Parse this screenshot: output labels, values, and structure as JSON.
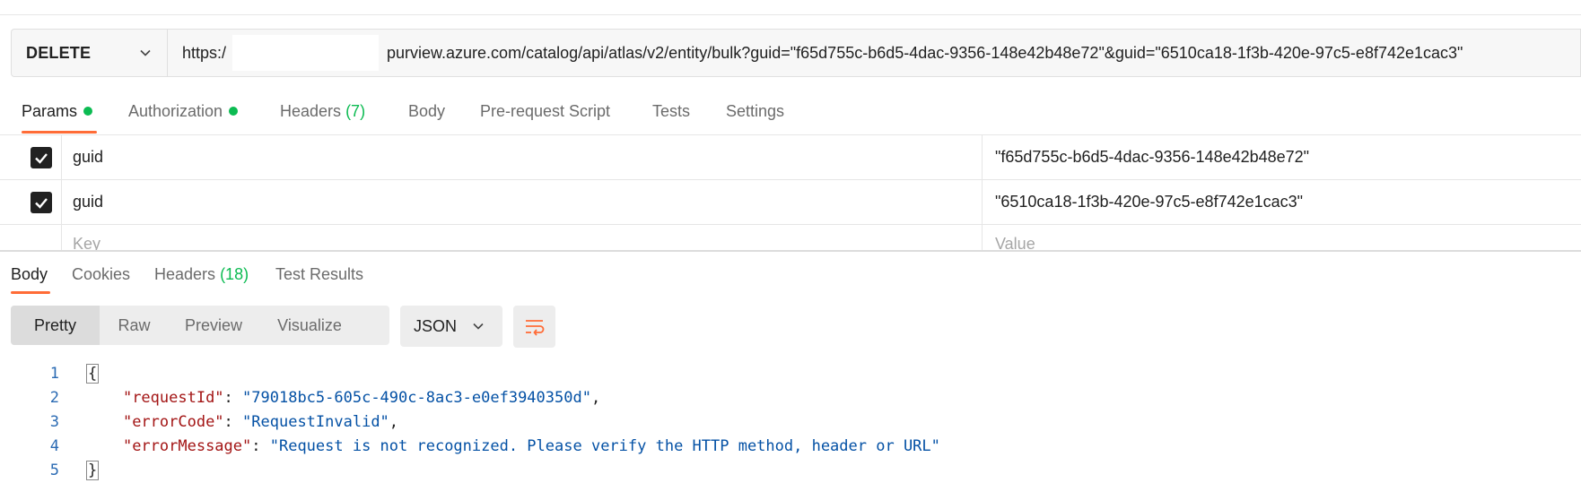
{
  "colors": {
    "accent": "#ff6c37",
    "ok_green": "#0cbb52",
    "json_key": "#a31515",
    "json_string": "#0451a5"
  },
  "request": {
    "method": "DELETE",
    "url_prefix": "https:/",
    "url_rest": "purview.azure.com/catalog/api/atlas/v2/entity/bulk?guid=\"f65d755c-b6d5-4dac-9356-148e42b48e72\"&guid=\"6510ca18-1f3b-420e-97c5-e8f742e1cac3\""
  },
  "request_tabs": {
    "params": "Params",
    "authorization": "Authorization",
    "headers": "Headers",
    "headers_count": "(7)",
    "body": "Body",
    "prerequest": "Pre-request Script",
    "tests": "Tests",
    "settings": "Settings"
  },
  "params": {
    "rows": [
      {
        "key": "guid",
        "value": "\"f65d755c-b6d5-4dac-9356-148e42b48e72\""
      },
      {
        "key": "guid",
        "value": "\"6510ca18-1f3b-420e-97c5-e8f742e1cac3\""
      }
    ],
    "key_placeholder": "Key",
    "value_placeholder": "Value"
  },
  "response_tabs": {
    "body": "Body",
    "cookies": "Cookies",
    "headers": "Headers",
    "headers_count": "(18)",
    "test_results": "Test Results"
  },
  "view": {
    "pretty": "Pretty",
    "raw": "Raw",
    "preview": "Preview",
    "visualize": "Visualize",
    "format": "JSON"
  },
  "code": {
    "line_numbers": [
      "1",
      "2",
      "3",
      "4",
      "5"
    ],
    "open_brace": "{",
    "close_brace": "}",
    "k1": "\"requestId\"",
    "v1": "\"79018bc5-605c-490c-8ac3-e0ef3940350d\"",
    "k2": "\"errorCode\"",
    "v2": "\"RequestInvalid\"",
    "k3": "\"errorMessage\"",
    "v3": "\"Request is not recognized. Please verify the HTTP method, header or URL\""
  }
}
